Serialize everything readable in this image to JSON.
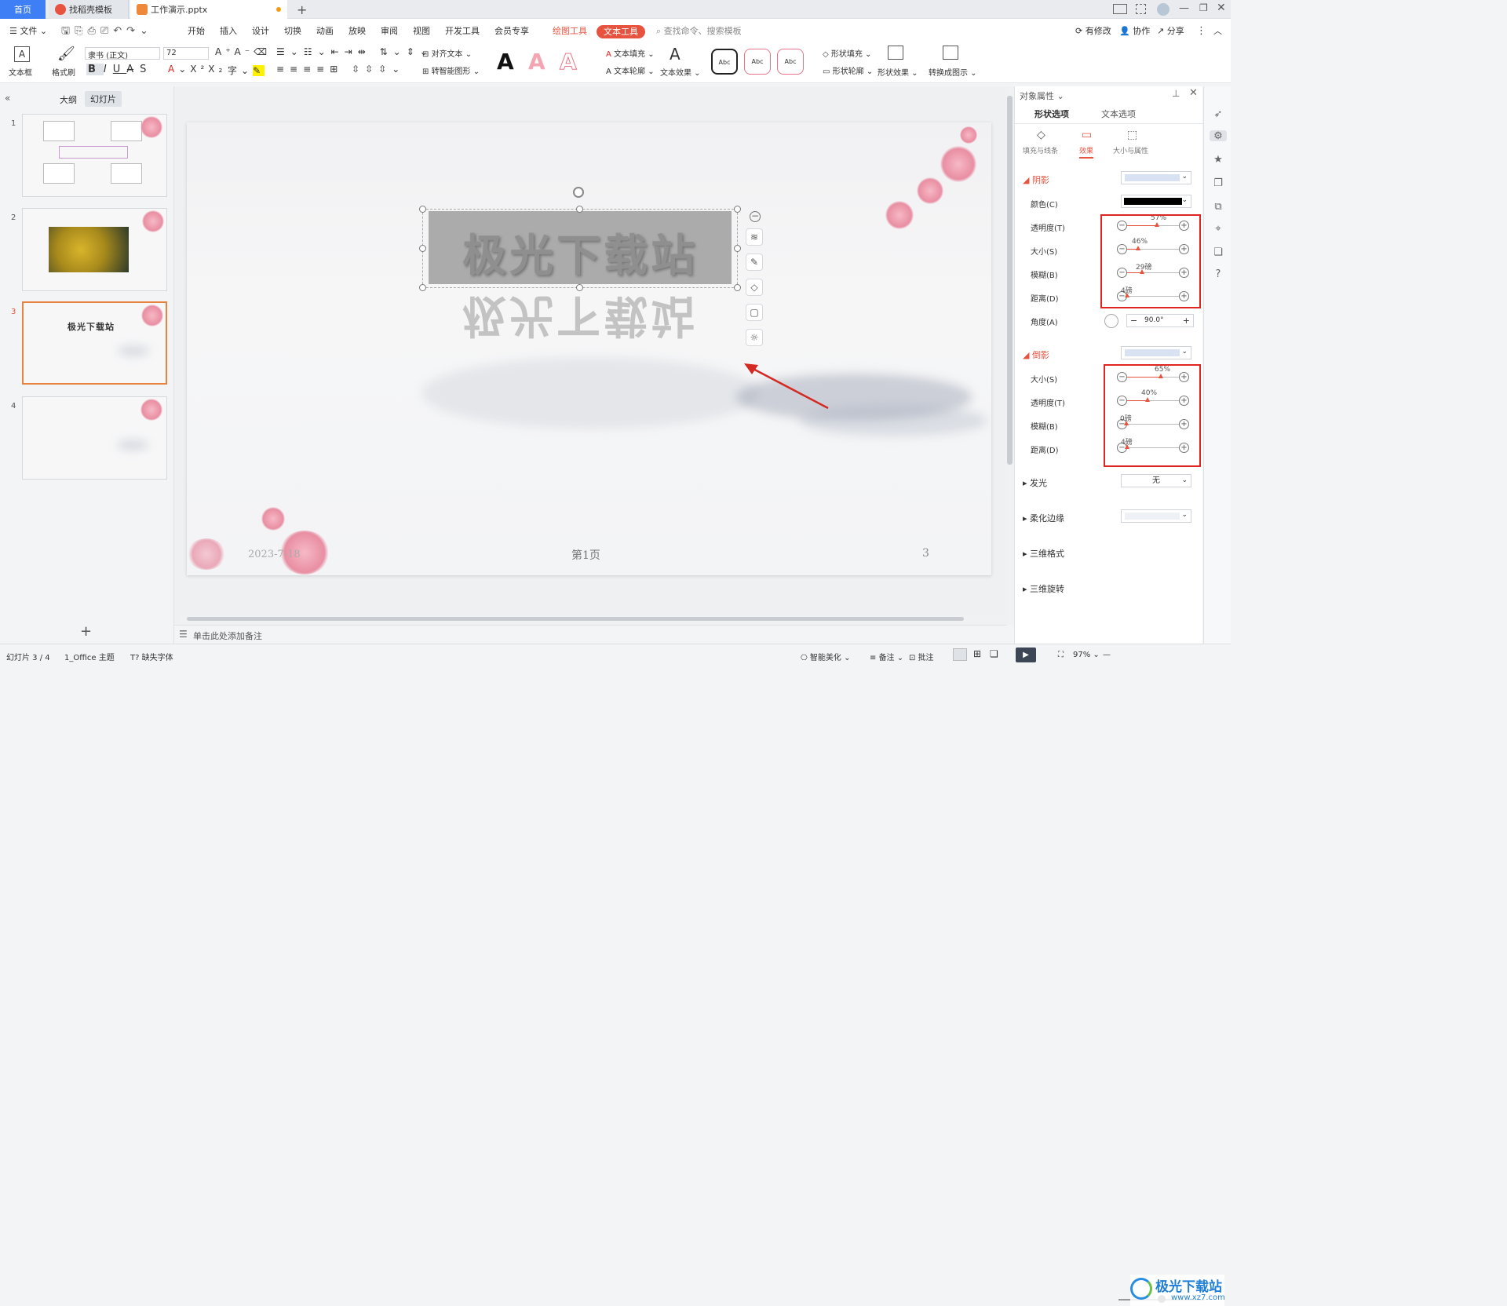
{
  "tabs": {
    "home": "首页",
    "template": "找稻壳模板",
    "doc": "工作演示.pptx",
    "new": "+"
  },
  "menu": {
    "file": "文件",
    "items": [
      "开始",
      "插入",
      "设计",
      "切换",
      "动画",
      "放映",
      "审阅",
      "视图",
      "开发工具",
      "会员专享"
    ],
    "drawing_tools": "绘图工具",
    "text_tools": "文本工具",
    "search": "查找命令、搜索模板",
    "modified": "有修改",
    "collab": "协作",
    "share": "分享"
  },
  "ribbon": {
    "textbox": "文本框",
    "format_painter": "格式刷",
    "font": "隶书 (正文)",
    "size": "72",
    "align_text": "对齐文本",
    "smart_shape": "转智能图形",
    "text_fill": "文本填充",
    "text_outline": "文本轮廓",
    "text_effect": "文本效果",
    "shape_fill": "形状填充",
    "shape_outline": "形状轮廓",
    "shape_effect": "形状效果",
    "convert_figure": "转换成图示",
    "abc": "Abc"
  },
  "leftpanel": {
    "outline": "大纲",
    "slides": "幻灯片",
    "add": "+"
  },
  "thumbs": [
    "1",
    "2",
    "3",
    "4"
  ],
  "thumb3_title": "极光下载站",
  "slide": {
    "title": "极光下载站",
    "date": "2023-7-18",
    "page_label": "第1页",
    "number": "3"
  },
  "notes": "单击此处添加备注",
  "rpanel": {
    "title": "对象属性",
    "tab_shape": "形状选项",
    "tab_text": "文本选项",
    "fill_line": "填充与线条",
    "effect": "效果",
    "size_prop": "大小与属性",
    "shadow": "阴影",
    "color": "颜色(C)",
    "shadow_rows": [
      {
        "label": "透明度(T)",
        "value": "57%",
        "frac": 0.57
      },
      {
        "label": "大小(S)",
        "value": "46%",
        "frac": 0.22
      },
      {
        "label": "模糊(B)",
        "value": "29磅",
        "frac": 0.29
      },
      {
        "label": "距离(D)",
        "value": "4磅",
        "frac": 0.02
      }
    ],
    "angle": "角度(A)",
    "angle_value": "90.0°",
    "reflection": "倒影",
    "reflection_rows": [
      {
        "label": "大小(S)",
        "value": "65%",
        "frac": 0.65
      },
      {
        "label": "透明度(T)",
        "value": "40%",
        "frac": 0.4
      },
      {
        "label": "模糊(B)",
        "value": "0磅",
        "frac": 0.0
      },
      {
        "label": "距离(D)",
        "value": "4磅",
        "frac": 0.02
      }
    ],
    "glow": "发光",
    "glow_value": "无",
    "soft_edge": "柔化边缘",
    "format3d": "三维格式",
    "rotate3d": "三维旋转"
  },
  "status": {
    "slide": "幻灯片 3 / 4",
    "theme": "1_Office 主题",
    "missing_font": "缺失字体",
    "beautify": "智能美化",
    "notes": "备注",
    "comment": "批注",
    "zoom": "97%"
  },
  "watermark": "极光下载站",
  "watermark_url": "www.xz7.com",
  "colors": {
    "accent": "#e8533f",
    "home_tab": "#3f7ff5",
    "highlight": "#e0241f"
  }
}
